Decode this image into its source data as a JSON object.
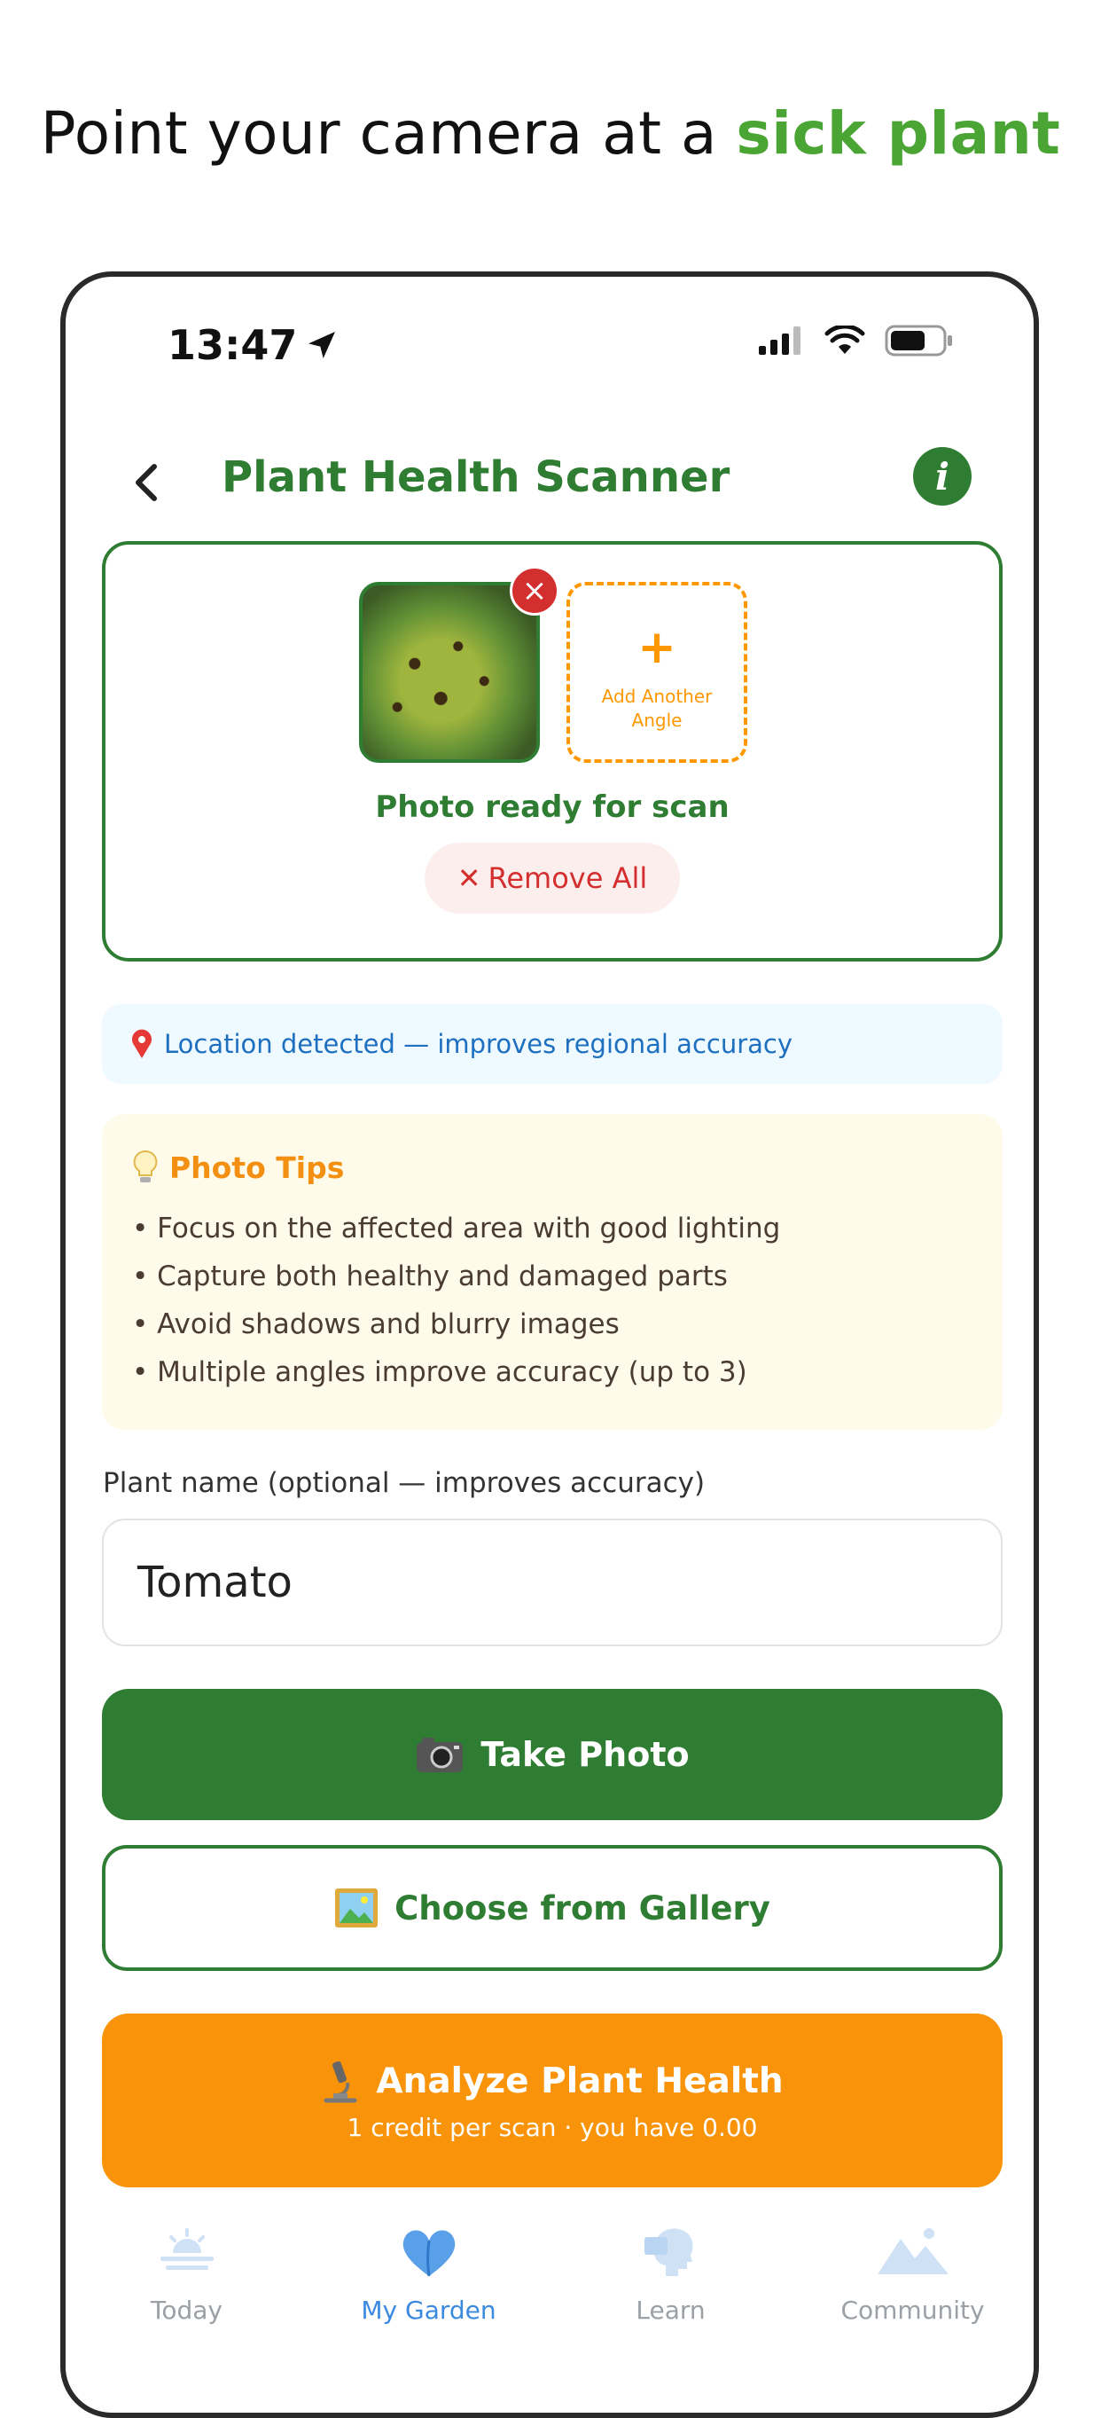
{
  "promo": {
    "prefix": "Point your camera at a ",
    "highlight": "sick plant"
  },
  "status": {
    "time": "13:47"
  },
  "header": {
    "title": "Plant Health Scanner",
    "info_label": "i"
  },
  "photos": {
    "remove_icon": "×",
    "add_plus": "+",
    "add_label_line1": "Add Another",
    "add_label_line2": "Angle",
    "ready_text": "Photo ready for scan",
    "remove_all_icon": "✕",
    "remove_all_label": "Remove All"
  },
  "location": {
    "icon": "pin-icon",
    "text": "Location detected — improves regional accuracy"
  },
  "tips": {
    "title": "Photo Tips",
    "items": [
      "• Focus on the affected area with good lighting",
      "• Capture both healthy and damaged parts",
      "• Avoid shadows and blurry images",
      "• Multiple angles improve accuracy (up to 3)"
    ]
  },
  "plant_name": {
    "label": "Plant name (optional — improves accuracy)",
    "value": "Tomato"
  },
  "buttons": {
    "take_photo": "Take Photo",
    "gallery": "Choose from Gallery",
    "analyze": "Analyze Plant Health",
    "analyze_sub": "1 credit per scan  ·  you have 0.00"
  },
  "tabs": [
    {
      "label": "Today",
      "icon": "sunrise-icon",
      "active": false
    },
    {
      "label": "My Garden",
      "icon": "heart-icon",
      "active": true
    },
    {
      "label": "Learn",
      "icon": "learn-head-icon",
      "active": false
    },
    {
      "label": "Community",
      "icon": "mountain-icon",
      "active": false
    }
  ],
  "colors": {
    "primary": "#2e7d32",
    "accent": "#ff9800",
    "danger": "#d32f2f",
    "link": "#3c8ae0"
  }
}
